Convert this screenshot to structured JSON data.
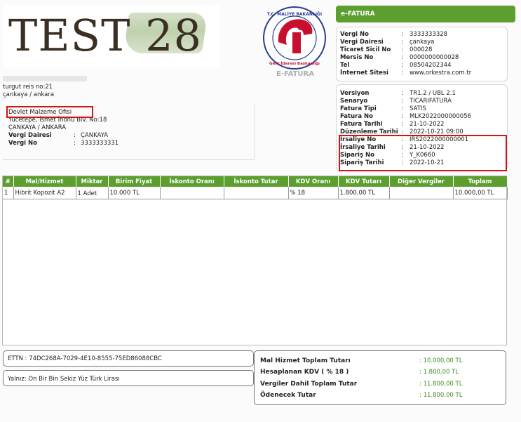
{
  "logo": {
    "text": "TEST 28"
  },
  "seal": {
    "caption": "E-FATURA",
    "ring_text": "T.C. MALİYE BAKANLIĞI · Gelir İdaresi Başkanlığı",
    "accent": "#c8102e"
  },
  "sender": {
    "address1": "turgut reis no:21",
    "address2": "çankaya / ankara"
  },
  "buyer": {
    "name": "Devlet Malzeme Ofisi",
    "address": "Yücetepe, İsmet İnönü Blv. No:18",
    "city": "ÇANKAYA / ANKARA",
    "tax_office_label": "Vergi Dairesi",
    "tax_office": "ÇANKAYA",
    "tax_no_label": "Vergi No",
    "tax_no": "3333333331"
  },
  "efatura_label": "e-FATURA",
  "seller_info": [
    {
      "label": "Vergi No",
      "value": "3333333328"
    },
    {
      "label": "Vergi Dairesi",
      "value": "çankaya"
    },
    {
      "label": "Ticaret Sicil No",
      "value": "000028"
    },
    {
      "label": "Mersis No",
      "value": "0000000000028"
    },
    {
      "label": "Tel",
      "value": "08504202344"
    },
    {
      "label": "İnternet Sitesi",
      "value": "www.orkestra.com.tr"
    }
  ],
  "doc_info": [
    {
      "label": "Versiyon",
      "value": "TR1.2 / UBL 2.1"
    },
    {
      "label": "Senaryo",
      "value": "TICARIFATURA"
    },
    {
      "label": "Fatura Tipi",
      "value": "SATIS"
    },
    {
      "label": "Fatura No",
      "value": "MLK2022000000056"
    },
    {
      "label": "Fatura Tarihi",
      "value": "21-10-2022"
    },
    {
      "label": "Düzenleme Tarihi",
      "value": "2022-10-21 09:00"
    },
    {
      "label": "İrsaliye No",
      "value": "IRS2022000000001"
    },
    {
      "label": "İrsaliye Tarihi",
      "value": "21-10-2022"
    },
    {
      "label": "Sipariş No",
      "value": "Y_K0660"
    },
    {
      "label": "Sipariş Tarihi",
      "value": "2022-10-21"
    }
  ],
  "table": {
    "columns": [
      "#",
      "Mal/Hizmet",
      "Miktar",
      "Birim Fiyat",
      "İskonto Oranı",
      "İskonto Tutar",
      "KDV Oranı",
      "KDV Tutarı",
      "Diğer Vergiler",
      "Toplam"
    ],
    "rows": [
      [
        "1",
        "Hibrit Kopozit A2",
        "1 Adet",
        "10.000 TL",
        "",
        "",
        "% 18",
        "1.800,00 TL",
        "",
        "10.000,00 TL"
      ]
    ]
  },
  "ettn": "ETTN : 74DC268A-7029-4E10-8555-75ED86088CBC",
  "amount_in_words": "Yalnız: On Bir Bin Sekiz Yüz Türk Lirası",
  "totals": [
    {
      "label": "Mal Hizmet Toplam Tutarı",
      "value": ": 10.000,00 TL"
    },
    {
      "label": "Hesaplanan KDV ( % 18 )",
      "value": ": 1.800,00 TL"
    },
    {
      "label": "Vergiler Dahil Toplam Tutar",
      "value": ": 11.800,00 TL"
    },
    {
      "label": "Ödenecek Tutar",
      "value": ": 11.800,00  TL"
    }
  ],
  "colors": {
    "header_green": "#5c9f2f",
    "total_value_green": "#3d8a1e",
    "highlight_red": "#d41319"
  }
}
